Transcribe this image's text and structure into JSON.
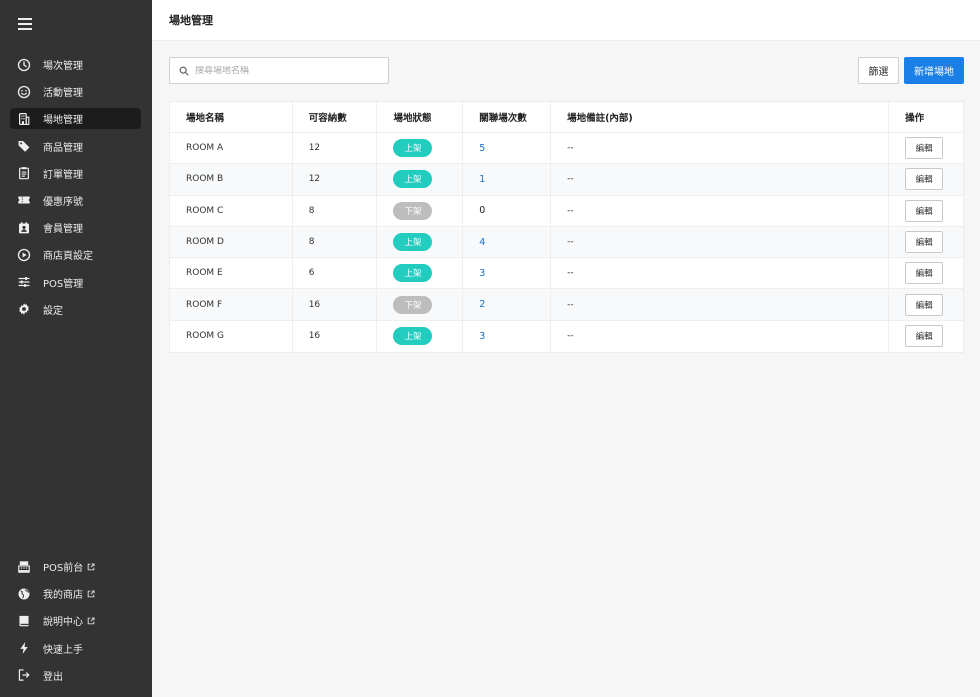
{
  "sidebar": {
    "items": [
      {
        "label": "場次管理",
        "icon": "clock-icon"
      },
      {
        "label": "活動管理",
        "icon": "smile-icon"
      },
      {
        "label": "場地管理",
        "icon": "building-icon",
        "active": true
      },
      {
        "label": "商品管理",
        "icon": "tag-icon"
      },
      {
        "label": "訂單管理",
        "icon": "clipboard-icon"
      },
      {
        "label": "優惠序號",
        "icon": "ticket-icon"
      },
      {
        "label": "會員管理",
        "icon": "member-icon"
      },
      {
        "label": "商店頁設定",
        "icon": "play-circle-icon"
      },
      {
        "label": "POS管理",
        "icon": "sliders-icon"
      },
      {
        "label": "設定",
        "icon": "gear-icon"
      }
    ],
    "bottom_items": [
      {
        "label": "POS前台",
        "icon": "register-icon",
        "external": true
      },
      {
        "label": "我的商店",
        "icon": "globe-icon",
        "external": true
      },
      {
        "label": "說明中心",
        "icon": "book-icon",
        "external": true
      },
      {
        "label": "快速上手",
        "icon": "bolt-icon",
        "external": false
      },
      {
        "label": "登出",
        "icon": "logout-icon",
        "external": false
      }
    ]
  },
  "header": {
    "title": "場地管理"
  },
  "toolbar": {
    "search_placeholder": "搜尋場地名稱",
    "filter_label": "篩選",
    "add_label": "新增場地"
  },
  "table": {
    "columns": [
      "場地名稱",
      "可容納數",
      "場地狀態",
      "關聯場次數",
      "場地備註(內部)",
      "操作"
    ],
    "edit_label": "編輯",
    "rows": [
      {
        "name": "ROOM A",
        "capacity": "12",
        "status": "上架",
        "status_on": true,
        "sessions": "5",
        "note": "--"
      },
      {
        "name": "ROOM B",
        "capacity": "12",
        "status": "上架",
        "status_on": true,
        "sessions": "1",
        "note": "--"
      },
      {
        "name": "ROOM C",
        "capacity": "8",
        "status": "下架",
        "status_on": false,
        "sessions": "0",
        "note": "--"
      },
      {
        "name": "ROOM D",
        "capacity": "8",
        "status": "上架",
        "status_on": true,
        "sessions": "4",
        "note": "--"
      },
      {
        "name": "ROOM E",
        "capacity": "6",
        "status": "上架",
        "status_on": true,
        "sessions": "3",
        "note": "--"
      },
      {
        "name": "ROOM F",
        "capacity": "16",
        "status": "下架",
        "status_on": false,
        "sessions": "2",
        "note": "--"
      },
      {
        "name": "ROOM G",
        "capacity": "16",
        "status": "上架",
        "status_on": true,
        "sessions": "3",
        "note": "--"
      }
    ]
  },
  "colors": {
    "sidebar_bg": "#333333",
    "accent": "#1a7fe6",
    "status_on": "#22cdbf",
    "status_off": "#bdbdbd",
    "link": "#1a6fc2"
  }
}
